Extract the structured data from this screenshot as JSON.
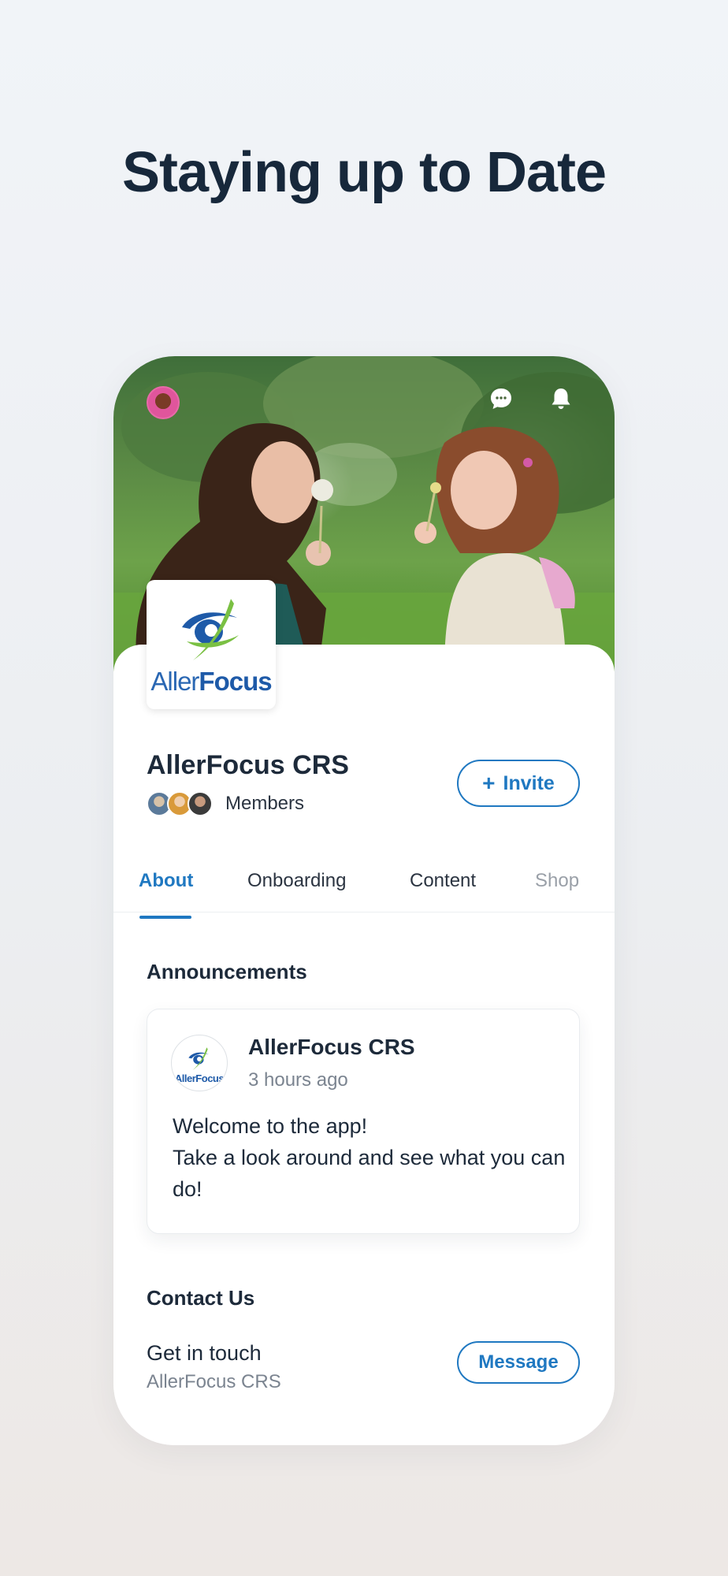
{
  "headline": "Staying up to Date",
  "group": {
    "logo_part1": "Aller",
    "logo_part2": "Focus",
    "title": "AllerFocus CRS",
    "members_label": "Members",
    "invite_label": "Invite"
  },
  "tabs": [
    {
      "label": "About"
    },
    {
      "label": "Onboarding"
    },
    {
      "label": "Content"
    },
    {
      "label": "Shop"
    }
  ],
  "announcements": {
    "title": "Announcements",
    "post": {
      "author": "AllerFocus CRS",
      "time": "3 hours ago",
      "text": "Welcome to the app!\nTake a look around and see what you can do!",
      "avatar_logo": "AllerFocus"
    }
  },
  "contact": {
    "title": "Contact Us",
    "subtitle": "Get in touch",
    "org": "AllerFocus CRS",
    "message_label": "Message"
  },
  "colors": {
    "accent": "#1f78c1",
    "text": "#1d2a3a",
    "muted": "#7b8490"
  }
}
